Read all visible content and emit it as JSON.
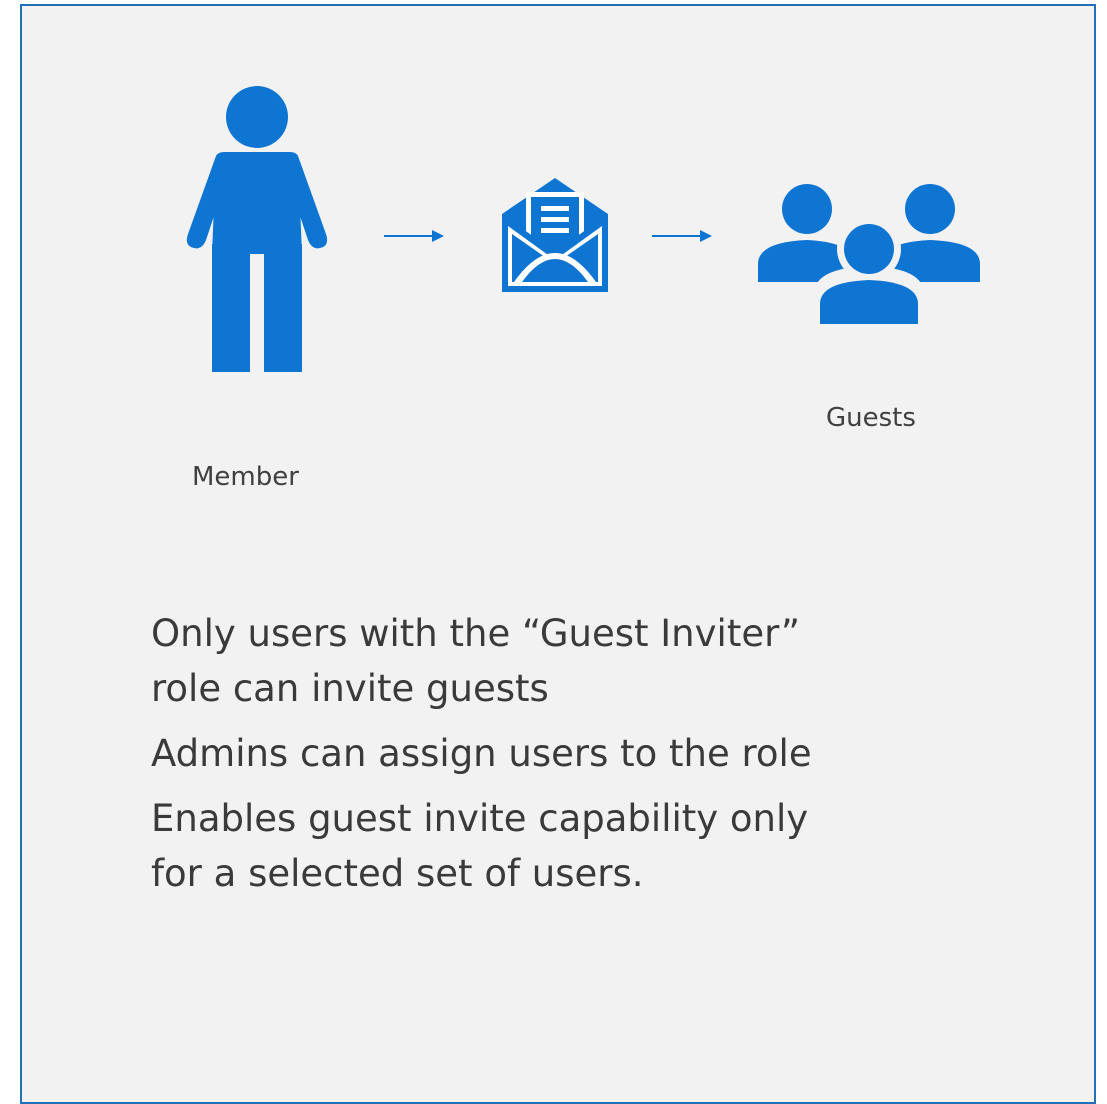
{
  "colors": {
    "accent": "#0f75d2",
    "panel_background": "#f2f2f2",
    "panel_border": "#1f6fba",
    "text": "#3a3a3a"
  },
  "flow": {
    "icons": [
      "person-icon",
      "arrow-right-icon",
      "envelope-letter-icon",
      "arrow-right-icon",
      "group-icon"
    ],
    "member_label": "Member",
    "guests_label": "Guests"
  },
  "bullets": [
    {
      "lines": [
        "Only users with the “Guest Inviter”",
        "role can invite guests"
      ]
    },
    {
      "lines": [
        "Admins can assign users to the role"
      ]
    },
    {
      "lines": [
        "Enables guest invite capability only",
        "for a selected set of users."
      ]
    }
  ]
}
